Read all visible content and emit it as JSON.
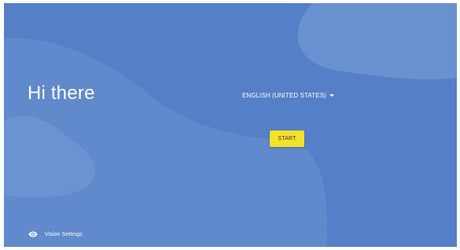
{
  "greeting": {
    "title": "Hi there"
  },
  "language_selector": {
    "selected": "ENGLISH (UNITED STATES)",
    "icon": "dropdown-arrow-icon"
  },
  "start_button": {
    "label": "START"
  },
  "vision_settings": {
    "label": "Vision Settings",
    "icon": "eye-icon"
  },
  "colors": {
    "background": "#5580c8",
    "start_button": "#f4e22a"
  }
}
